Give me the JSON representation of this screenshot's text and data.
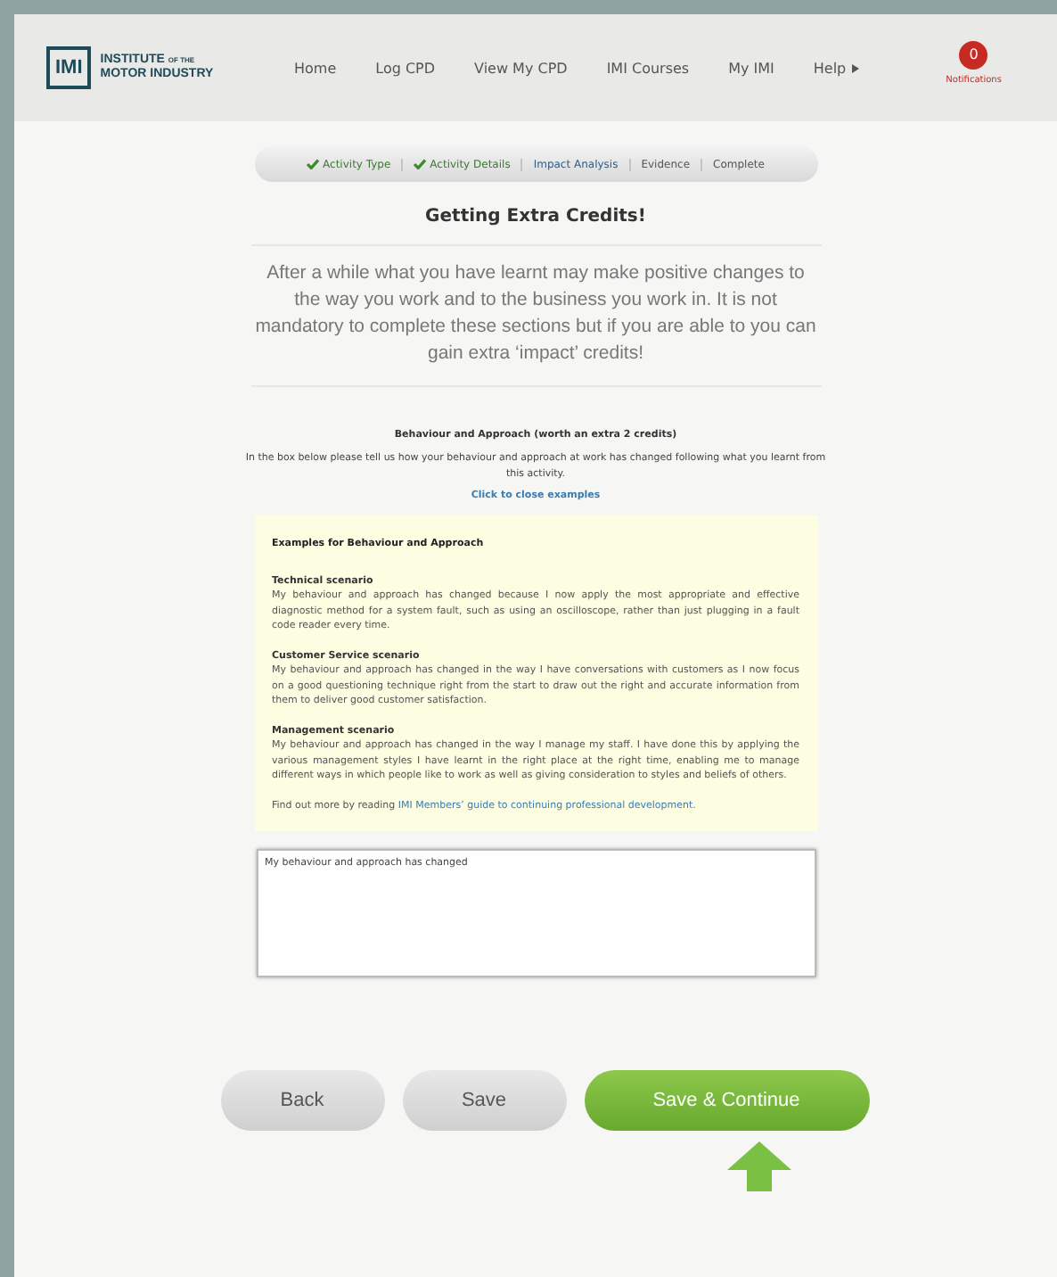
{
  "header": {
    "logo_mark": "IMI",
    "logo_small": "OF THE",
    "logo_line1": "INSTITUTE",
    "logo_line2": "MOTOR INDUSTRY",
    "nav": [
      {
        "label": "Home",
        "has_menu": false
      },
      {
        "label": "Log CPD",
        "has_menu": false
      },
      {
        "label": "View My CPD",
        "has_menu": false
      },
      {
        "label": "IMI Courses",
        "has_menu": false
      },
      {
        "label": "My IMI",
        "has_menu": false
      },
      {
        "label": "Help",
        "has_menu": true
      }
    ],
    "notifications": {
      "count": "0",
      "label": "Notifications"
    }
  },
  "steps": [
    {
      "label": "Activity Type",
      "done": true,
      "selected": false
    },
    {
      "label": "Activity Details",
      "done": true,
      "selected": false
    },
    {
      "label": "Impact Analysis",
      "done": false,
      "selected": true
    },
    {
      "label": "Evidence",
      "done": false,
      "selected": false
    },
    {
      "label": "Complete",
      "done": false,
      "selected": false
    }
  ],
  "title": "Getting Extra Credits!",
  "intro": "After a while what you have learnt may make positive changes to the way you work and to the business you work in. It is not mandatory to complete these sections but if you are able to you can gain extra ‘impact’ credits!",
  "section_title": "Behaviour and Approach (worth an extra 2 credits)",
  "section_text": "In the box below please tell us how your behaviour and approach at work has changed following what you learnt from this activity.",
  "toggle_link": "Click to close examples",
  "examples": {
    "heading": "Examples for Behaviour and Approach",
    "items": [
      {
        "title": "Technical scenario",
        "text": "My behaviour and approach has changed because I now apply the most appropriate and effective diagnostic method for a system fault, such as using an oscilloscope, rather than just plugging in a fault code reader every time."
      },
      {
        "title": "Customer Service scenario",
        "text": "My behaviour and approach has changed in the way I have conversations with customers as I now focus on a good questioning technique right from the start to draw out the right and accurate information from them to deliver good customer satisfaction."
      },
      {
        "title": "Management scenario",
        "text": "My behaviour and approach has changed in the way I manage my staff. I have done this by applying the various management styles I have learnt in the right place at the right time, enabling me to manage different ways in which people like to work as well as giving consideration to styles and beliefs of others."
      }
    ],
    "footer_text": "Find out more by reading",
    "footer_link": "IMI Members’ guide to continuing professional development."
  },
  "answer": {
    "value": "My behaviour and approach has changed"
  },
  "buttons": [
    {
      "label": "Back",
      "kind": "grey"
    },
    {
      "label": "Save",
      "kind": "grey"
    },
    {
      "label": "Save & Continue",
      "kind": "primary"
    }
  ]
}
